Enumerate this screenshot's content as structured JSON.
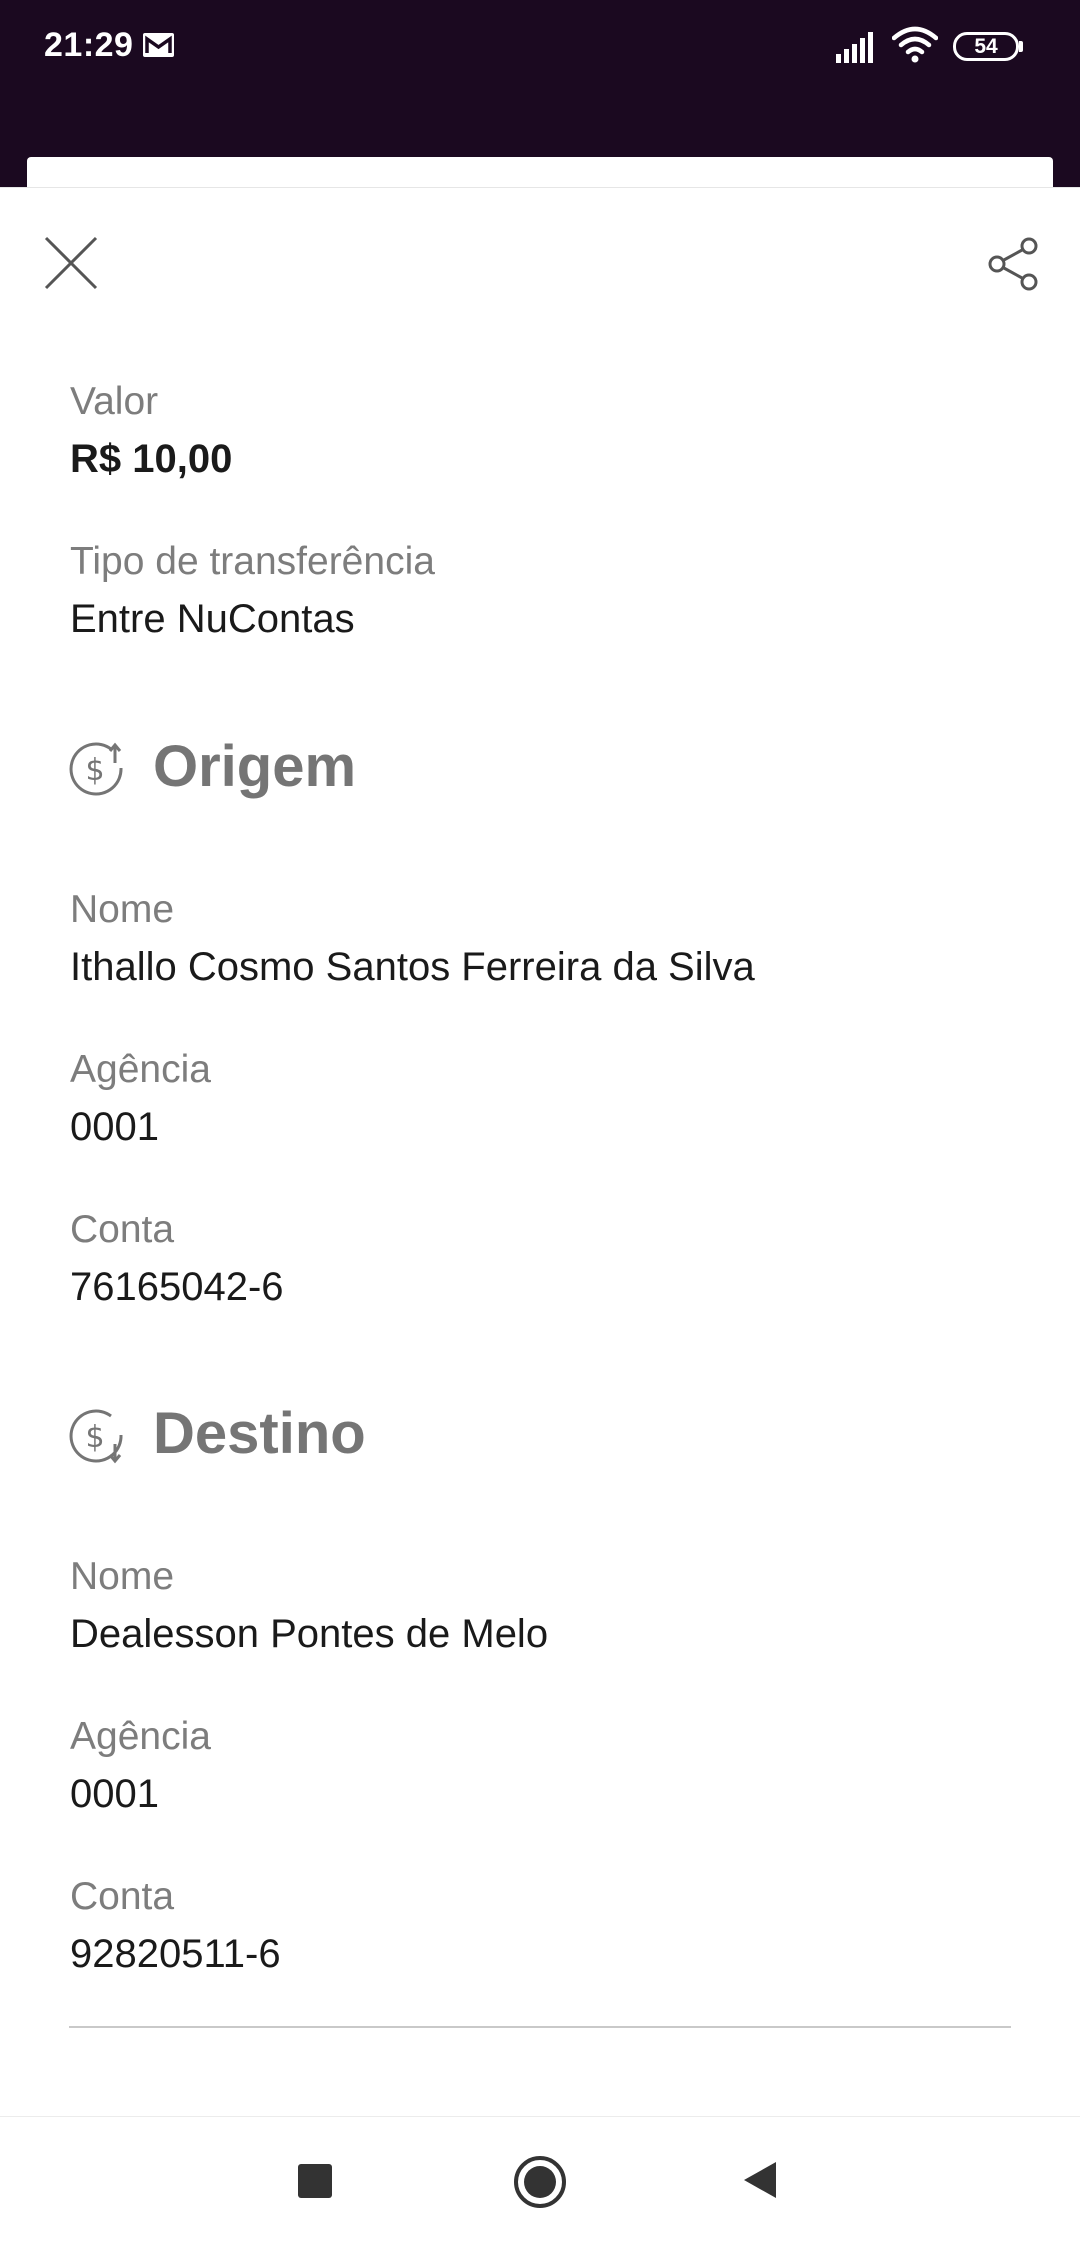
{
  "status_bar": {
    "time": "21:29",
    "notification_icon": "gmail-icon",
    "signal_icon": "cell-signal-icon",
    "wifi_icon": "wifi-icon",
    "battery_level": "54"
  },
  "header": {
    "close_icon": "close-icon",
    "share_icon": "share-icon"
  },
  "summary": {
    "amount_label": "Valor",
    "amount_value": "R$ 10,00",
    "type_label": "Tipo de transferência",
    "type_value": "Entre NuContas"
  },
  "origin": {
    "title": "Origem",
    "icon": "money-out-icon",
    "name_label": "Nome",
    "name_value": "Ithallo Cosmo Santos Ferreira da Silva",
    "agency_label": "Agência",
    "agency_value": "0001",
    "account_label": "Conta",
    "account_value": "76165042-6"
  },
  "destination": {
    "title": "Destino",
    "icon": "money-in-icon",
    "name_label": "Nome",
    "name_value": "Dealesson Pontes de Melo",
    "agency_label": "Agência",
    "agency_value": "0001",
    "account_label": "Conta",
    "account_value": "92820511-6"
  },
  "nav_bar": {
    "recent_icon": "recent-apps-icon",
    "home_icon": "home-icon",
    "back_icon": "back-icon"
  },
  "colors": {
    "status_bar_bg": "#1b0920",
    "label_gray": "#7d7d7d",
    "section_title_gray": "#757575",
    "value_black": "#1a1a1a"
  }
}
